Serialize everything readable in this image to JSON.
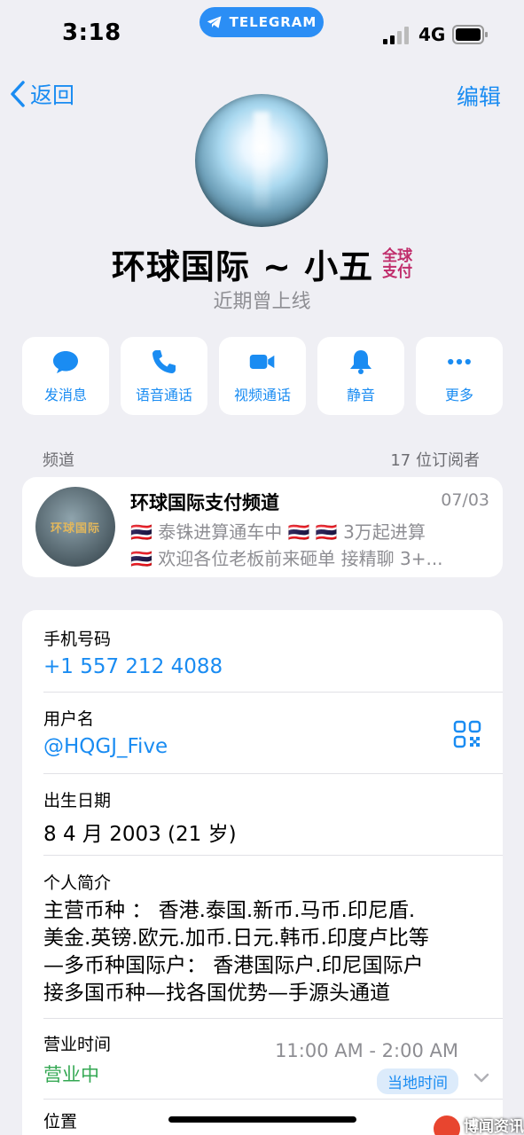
{
  "status_bar": {
    "time": "3:18",
    "app_pill": "TELEGRAM",
    "network": "4G"
  },
  "nav": {
    "back_label": "返回",
    "edit_label": "编辑"
  },
  "profile": {
    "name": "环球国际 ~ 小五",
    "badge_line1": "全球",
    "badge_line2": "支付",
    "last_seen": "近期曾上线"
  },
  "actions": [
    {
      "label": "发消息",
      "icon": "message-bubble-icon"
    },
    {
      "label": "语音通话",
      "icon": "phone-icon"
    },
    {
      "label": "视频通话",
      "icon": "video-camera-icon"
    },
    {
      "label": "静音",
      "icon": "bell-icon"
    },
    {
      "label": "更多",
      "icon": "more-dots-icon"
    }
  ],
  "channel_section": {
    "label": "频道",
    "subscribers": "17 位订阅者"
  },
  "channel": {
    "avatar_text": "环球国际",
    "title": "环球国际支付频道",
    "date": "07/03",
    "line1": "🇹🇭 泰铢进算通车中 🇹🇭 🇹🇭 3万起进算",
    "line2": "🇹🇭 欢迎各位老板前来砸单 接精聊 3+..."
  },
  "info": {
    "phone_label": "手机号码",
    "phone_value": "+1 557 212 4088",
    "username_label": "用户名",
    "username_value": "@HQGJ_Five",
    "birthday_label": "出生日期",
    "birthday_value": "8 4 月 2003 (21 岁)",
    "bio_label": "个人简介",
    "bio_lines": [
      "主营币种 ： 香港.泰国.新币.马币.印尼盾.",
      "美金.英镑.欧元.加币.日元.韩币.印度卢比等",
      "—多币种国际户： 香港国际户.印尼国际户",
      "接多国币种—找各国优势—手源头通道"
    ],
    "hours_label": "营业时间",
    "hours_range": "11:00 AM - 2:00 AM",
    "hours_status": "营业中",
    "local_time_label": "当地时间",
    "location_label": "位置"
  },
  "watermark": "博闻资讯",
  "colors": {
    "accent": "#1a8cf2",
    "open_green": "#34a853",
    "background": "#efeff4"
  }
}
